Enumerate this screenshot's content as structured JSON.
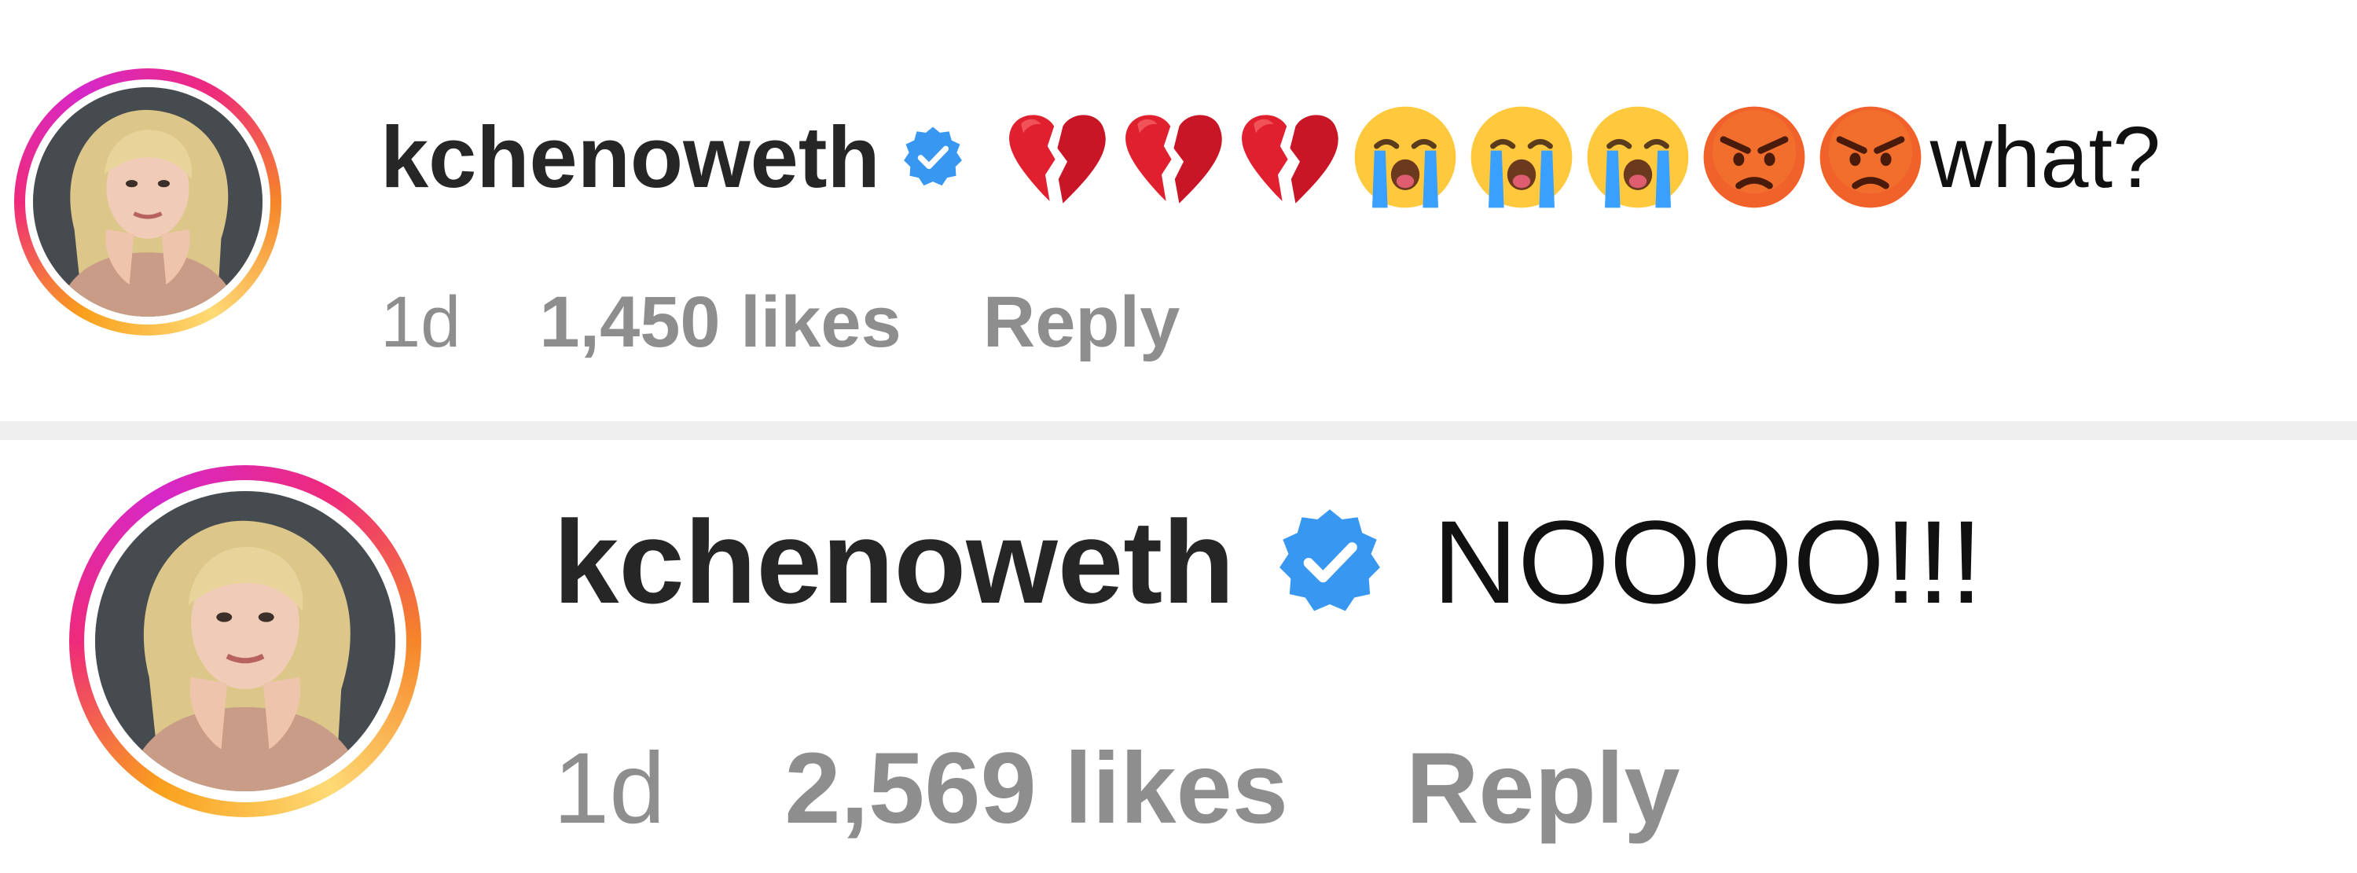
{
  "comments": [
    {
      "username": "kchenoweth",
      "verified": true,
      "emojis": [
        "broken-heart",
        "broken-heart",
        "broken-heart",
        "loudly-crying-face",
        "loudly-crying-face",
        "loudly-crying-face",
        "angry-face",
        "angry-face"
      ],
      "text": "what?",
      "time": "1d",
      "likes": "1,450 likes",
      "reply_label": "Reply"
    },
    {
      "username": "kchenoweth",
      "verified": true,
      "emojis": [],
      "text": "NOOOO!!!",
      "time": "1d",
      "likes": "2,569 likes",
      "reply_label": "Reply"
    }
  ],
  "colors": {
    "verified_blue": "#3897f0",
    "meta_gray": "#8e8e8e",
    "username": "#262626",
    "divider": "#efefef"
  }
}
